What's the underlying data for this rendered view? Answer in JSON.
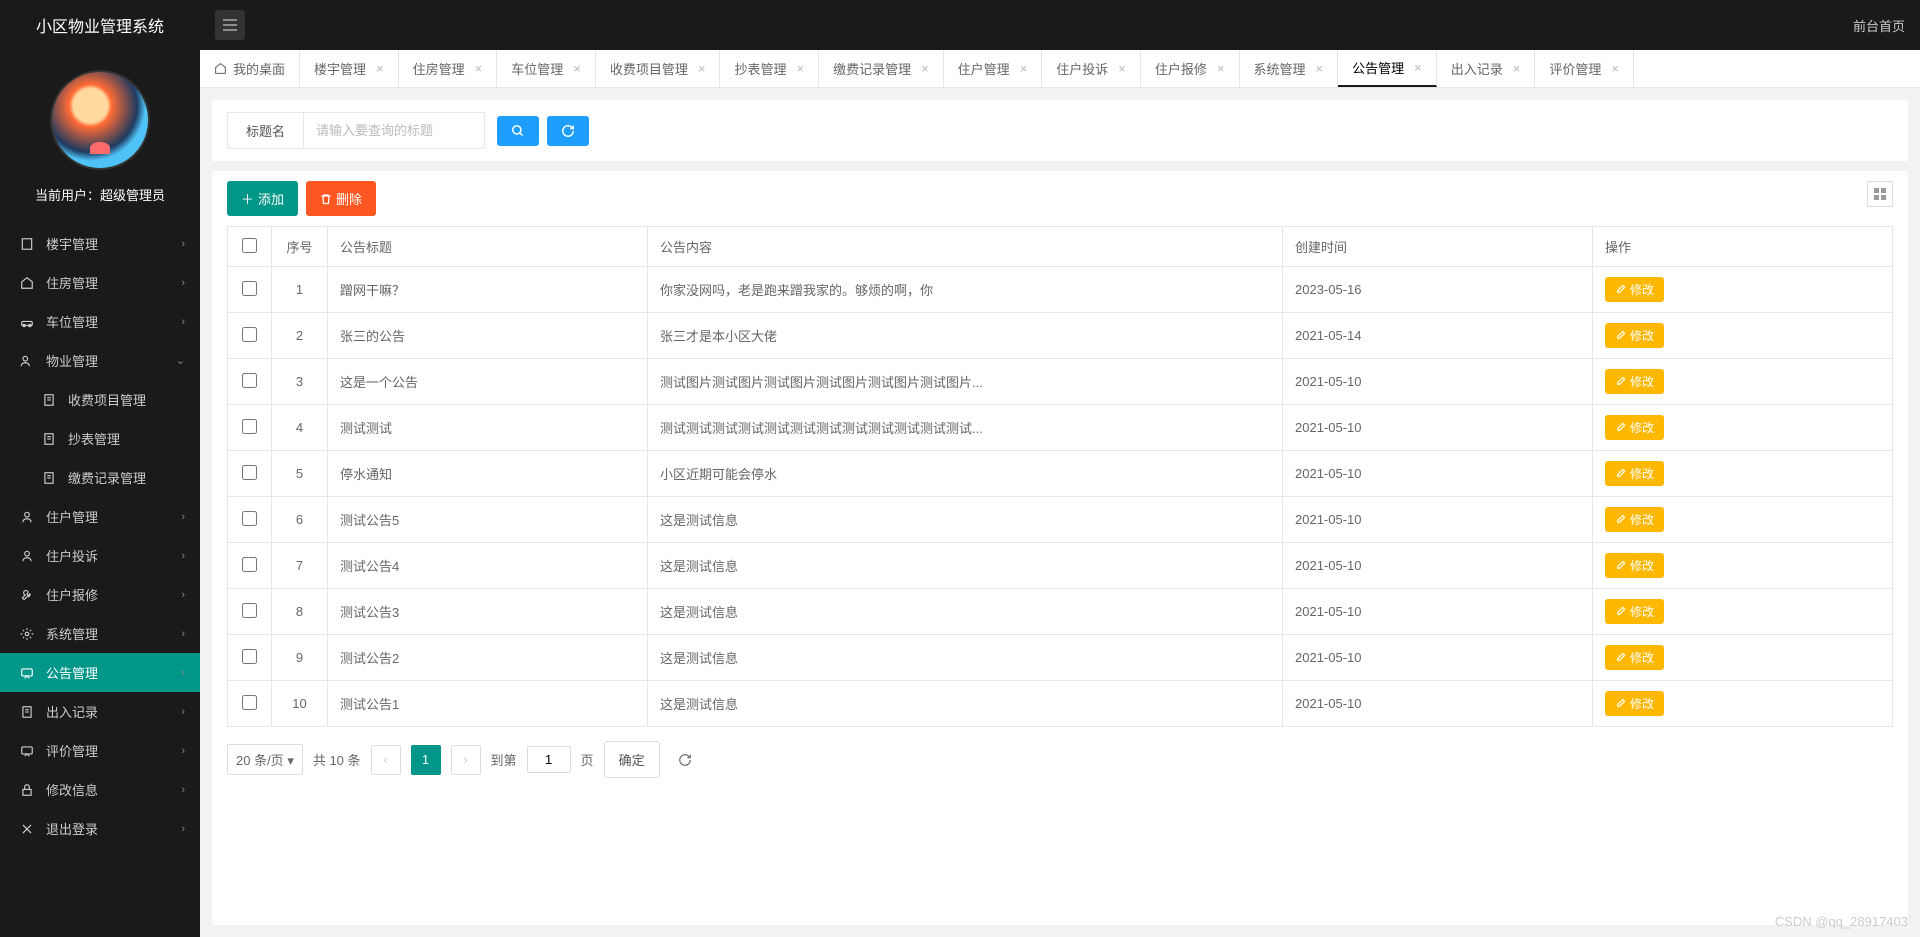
{
  "app_title": "小区物业管理系统",
  "topbar": {
    "front_link": "前台首页"
  },
  "user": {
    "label": "当前用户：超级管理员"
  },
  "sidebar": [
    {
      "icon": "building",
      "label": "楼宇管理",
      "arrow": "right"
    },
    {
      "icon": "house",
      "label": "住房管理",
      "arrow": "right"
    },
    {
      "icon": "car",
      "label": "车位管理",
      "arrow": "right"
    },
    {
      "icon": "users",
      "label": "物业管理",
      "arrow": "down"
    },
    {
      "icon": "doc",
      "label": "收费项目管理",
      "sub": true
    },
    {
      "icon": "doc",
      "label": "抄表管理",
      "sub": true
    },
    {
      "icon": "doc",
      "label": "缴费记录管理",
      "sub": true
    },
    {
      "icon": "person",
      "label": "住户管理",
      "arrow": "right"
    },
    {
      "icon": "person",
      "label": "住户投诉",
      "arrow": "right"
    },
    {
      "icon": "wrench",
      "label": "住户报修",
      "arrow": "right"
    },
    {
      "icon": "gear",
      "label": "系统管理",
      "arrow": "right"
    },
    {
      "icon": "chat",
      "label": "公告管理",
      "arrow": "right",
      "active": true
    },
    {
      "icon": "doc",
      "label": "出入记录",
      "arrow": "right"
    },
    {
      "icon": "chat",
      "label": "评价管理",
      "arrow": "right"
    },
    {
      "icon": "lock",
      "label": "修改信息",
      "arrow": "right"
    },
    {
      "icon": "x",
      "label": "退出登录",
      "arrow": "right"
    }
  ],
  "tabs": [
    {
      "label": "我的桌面",
      "home": true
    },
    {
      "label": "楼宇管理"
    },
    {
      "label": "住房管理"
    },
    {
      "label": "车位管理"
    },
    {
      "label": "收费项目管理"
    },
    {
      "label": "抄表管理"
    },
    {
      "label": "缴费记录管理"
    },
    {
      "label": "住户管理"
    },
    {
      "label": "住户投诉"
    },
    {
      "label": "住户报修"
    },
    {
      "label": "系统管理"
    },
    {
      "label": "公告管理",
      "active": true
    },
    {
      "label": "出入记录"
    },
    {
      "label": "评价管理"
    }
  ],
  "search": {
    "label": "标题名",
    "placeholder": "请输入要查询的标题"
  },
  "toolbar": {
    "add": "添加",
    "delete": "删除"
  },
  "table": {
    "headers": {
      "seq": "序号",
      "title": "公告标题",
      "content": "公告内容",
      "time": "创建时间",
      "op": "操作"
    },
    "edit_label": "修改",
    "rows": [
      {
        "seq": "1",
        "title": "蹭网干嘛？",
        "content": "你家没网吗，老是跑来蹭我家的。够烦的啊，你",
        "time": "2023-05-16"
      },
      {
        "seq": "2",
        "title": "张三的公告",
        "content": "张三才是本小区大佬",
        "time": "2021-05-14"
      },
      {
        "seq": "3",
        "title": "这是一个公告",
        "content": "测试图片测试图片测试图片测试图片测试图片测试图片...",
        "time": "2021-05-10"
      },
      {
        "seq": "4",
        "title": "测试测试",
        "content": "测试测试测试测试测试测试测试测试测试测试测试测试...",
        "time": "2021-05-10"
      },
      {
        "seq": "5",
        "title": "停水通知",
        "content": "小区近期可能会停水",
        "time": "2021-05-10"
      },
      {
        "seq": "6",
        "title": "测试公告5",
        "content": "这是测试信息",
        "time": "2021-05-10"
      },
      {
        "seq": "7",
        "title": "测试公告4",
        "content": "这是测试信息",
        "time": "2021-05-10"
      },
      {
        "seq": "8",
        "title": "测试公告3",
        "content": "这是测试信息",
        "time": "2021-05-10"
      },
      {
        "seq": "9",
        "title": "测试公告2",
        "content": "这是测试信息",
        "time": "2021-05-10"
      },
      {
        "seq": "10",
        "title": "测试公告1",
        "content": "这是测试信息",
        "time": "2021-05-10"
      }
    ]
  },
  "pager": {
    "page_size": "20 条/页",
    "total": "共 10 条",
    "current": "1",
    "goto_label": "到第",
    "goto_value": "1",
    "page_word": "页",
    "confirm": "确定"
  },
  "watermark": "CSDN @qq_28917403"
}
